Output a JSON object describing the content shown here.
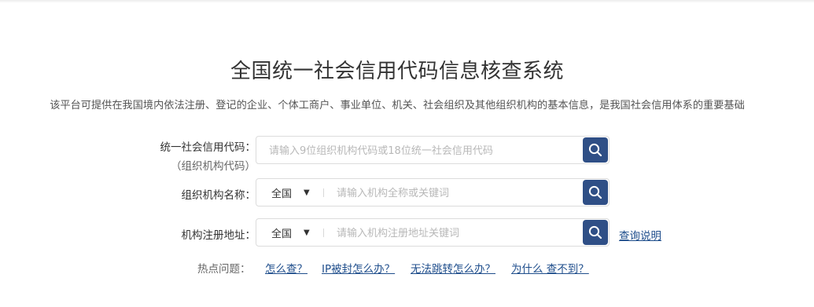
{
  "title": "全国统一社会信用代码信息核查系统",
  "subtitle": "该平台可提供在我国境内依法注册、登记的企业、个体工商户、事业单位、机关、社会组织及其他组织机构的基本信息，是我国社会信用体系的重要基础",
  "code_search": {
    "label": "统一社会信用代码：",
    "label_sub": "（组织机构代码）",
    "placeholder": "请输入9位组织机构代码或18位统一社会信用代码"
  },
  "name_search": {
    "label": "组织机构名称：",
    "region": "全国",
    "placeholder": "请输入机构全称或关键词"
  },
  "address_search": {
    "label": "机构注册地址：",
    "region": "全国",
    "placeholder": "请输入机构注册地址关键词",
    "help_link": "查询说明"
  },
  "hot_questions": {
    "label": "热点问题：",
    "items": [
      "怎么查？",
      "IP被封怎么办？",
      "无法跳转怎么办？",
      "为什么 查不到？"
    ]
  },
  "colors": {
    "button": "#2f4f86",
    "link": "#1f4e8c"
  },
  "icons": {
    "search": "magnifier-icon",
    "dropdown": "caret-down-icon"
  }
}
